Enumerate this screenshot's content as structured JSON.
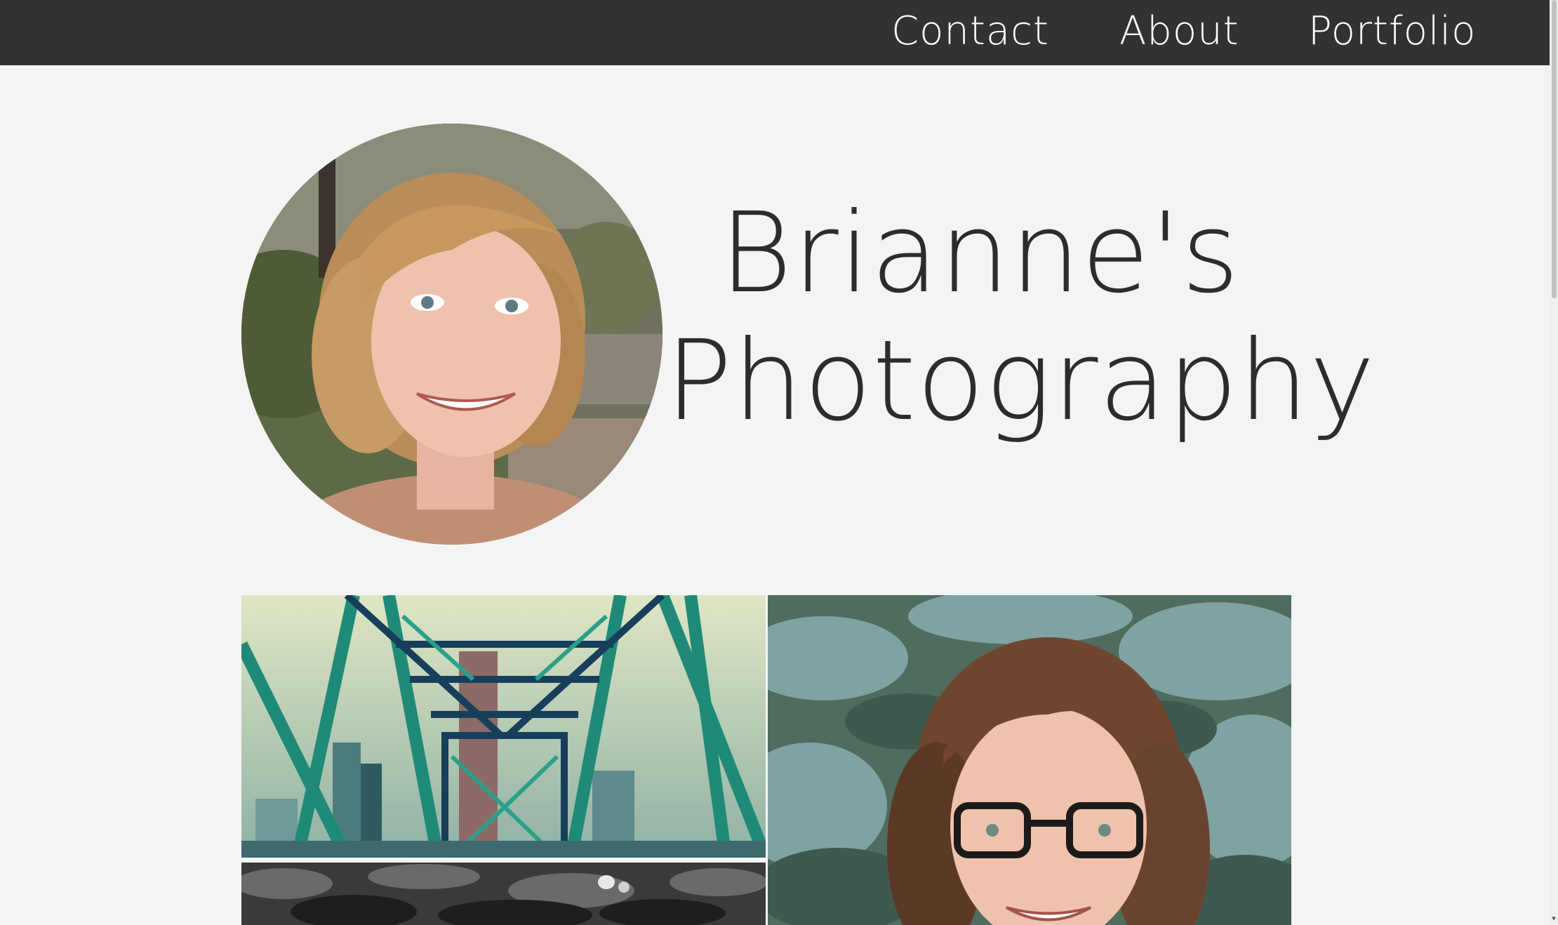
{
  "nav": {
    "items": [
      {
        "label": "Contact"
      },
      {
        "label": "About"
      },
      {
        "label": "Portfolio"
      }
    ]
  },
  "hero": {
    "title_line1": "Brianne's",
    "title_line2": "Photography"
  },
  "colors": {
    "nav_background": "#333231",
    "page_background": "#f4f4f4",
    "title_text": "#2c2c2c",
    "nav_text": "#ffffff"
  },
  "icons": {
    "scroll_down": "scroll-down-arrow-icon"
  }
}
